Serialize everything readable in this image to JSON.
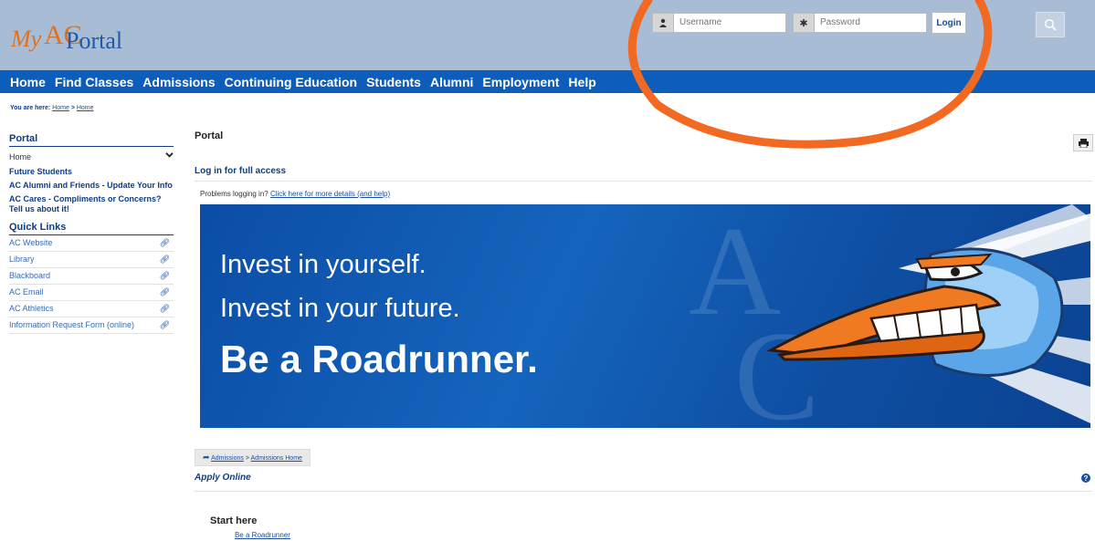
{
  "header": {
    "logo": {
      "my": "My",
      "ac": "AC",
      "portal": "Portal"
    },
    "username_placeholder": "Username",
    "password_placeholder": "Password",
    "login_label": "Login",
    "search_icon": "search-icon"
  },
  "nav": {
    "items": [
      "Home",
      "Find Classes",
      "Admissions",
      "Continuing Education",
      "Students",
      "Alumni",
      "Employment",
      "Help"
    ]
  },
  "you_are_here": {
    "label": "You are here:",
    "crumb1": "Home",
    "separator": ">",
    "crumb2": "Home"
  },
  "sidebar": {
    "portal_heading": "Portal",
    "home_label": "Home",
    "links": [
      "Future Students",
      "AC Alumni and Friends - Update Your Info",
      "AC Cares - Compliments or Concerns? Tell us about it!"
    ],
    "quick_links_heading": "Quick Links",
    "quick_links": [
      "AC Website",
      "Library",
      "Blackboard",
      "AC Email",
      "AC Athletics",
      "Information Request Form (online)"
    ]
  },
  "main": {
    "title": "Portal",
    "login_full_access": "Log in for full access",
    "problems_text": "Problems logging in?",
    "problems_link": "Click here for more details (and help)",
    "banner": {
      "line1": "Invest in yourself.",
      "line2": "Invest in your future.",
      "line3": "Be a Roadrunner."
    },
    "breadcrumb": {
      "crumb1": "Admissions",
      "separator": ">",
      "crumb2": "Admissions Home"
    },
    "apply_online": "Apply Online",
    "start_here": "Start here",
    "be_roadrunner_link": "Be a Roadrunner"
  },
  "colors": {
    "header_bg": "#a9bcd5",
    "nav_bg": "#0d5dba",
    "brand_orange": "#e2711d",
    "link_blue": "#1a4fa0",
    "annotation_orange": "#f26a21"
  }
}
